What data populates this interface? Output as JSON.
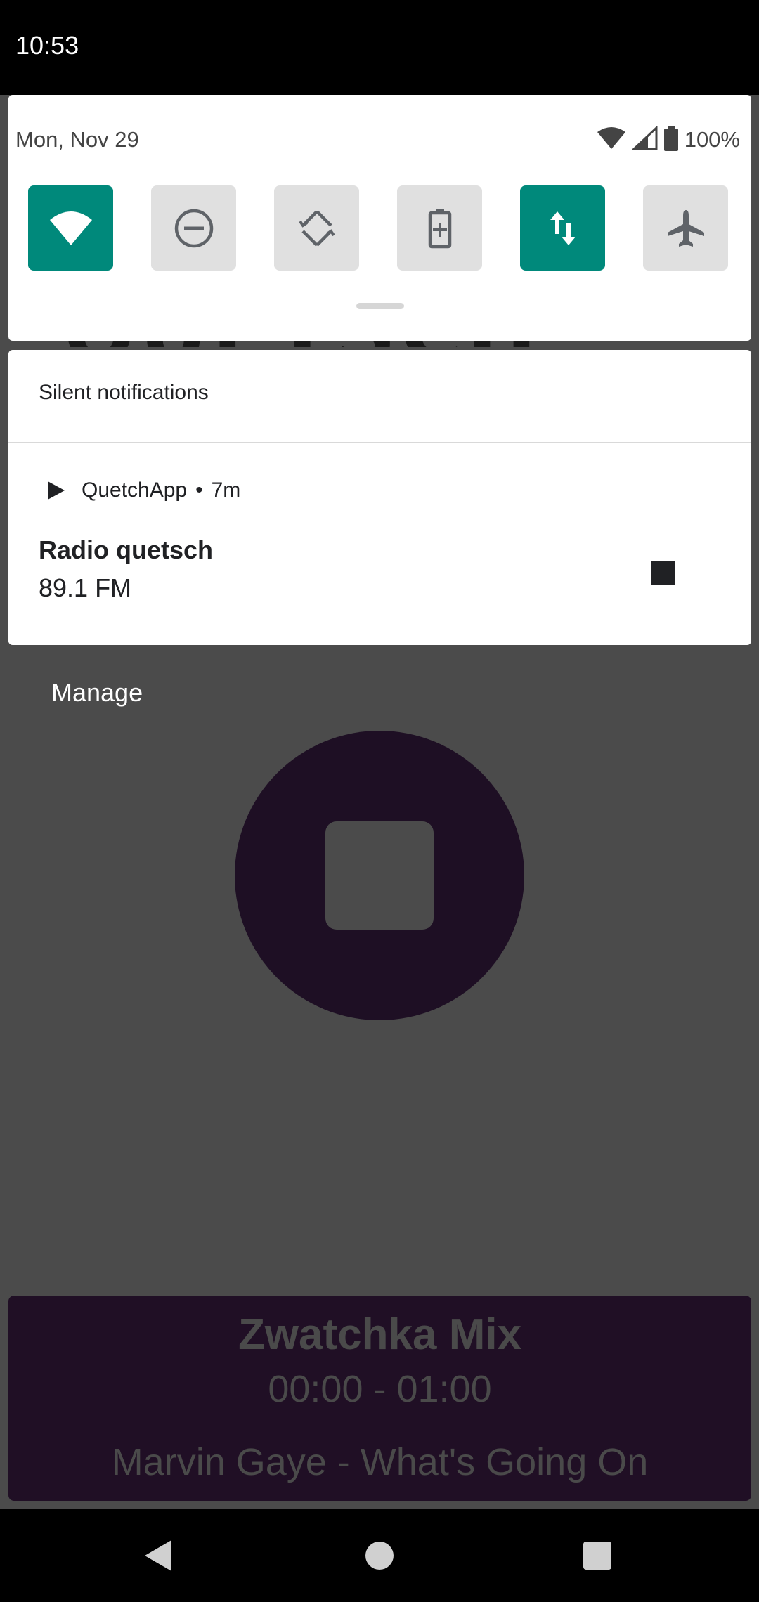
{
  "status_bar": {
    "time": "10:53"
  },
  "quick_settings": {
    "date": "Mon, Nov 29",
    "battery_percent": "100%",
    "status_icons": [
      "wifi-icon",
      "cellular-signal-icon",
      "battery-full-icon"
    ],
    "tiles": [
      {
        "name": "wifi",
        "icon": "wifi-icon",
        "active": true
      },
      {
        "name": "do-not-disturb",
        "icon": "do-not-disturb-icon",
        "active": false
      },
      {
        "name": "auto-rotate",
        "icon": "auto-rotate-icon",
        "active": false
      },
      {
        "name": "battery-saver",
        "icon": "battery-saver-icon",
        "active": false
      },
      {
        "name": "mobile-data",
        "icon": "mobile-data-icon",
        "active": true
      },
      {
        "name": "airplane-mode",
        "icon": "airplane-icon",
        "active": false
      }
    ],
    "colors": {
      "tile_active": "#00897b",
      "tile_inactive": "#e0e0e0"
    }
  },
  "notifications": {
    "section_header": "Silent notifications",
    "media": {
      "app_name": "QuetchApp",
      "separator": "•",
      "time_ago": "7m",
      "title": "Radio quetsch",
      "text": "89.1 FM",
      "action_icon": "stop-icon"
    },
    "manage_label": "Manage"
  },
  "app_background": {
    "show_title": "Zwatchka Mix",
    "show_time": "00:00 - 01:00",
    "track": "Marvin Gaye - What's Going On",
    "stop_button_icon": "stop-icon",
    "logo_text": "QUETSCH",
    "colors": {
      "accent": "#1e0f24",
      "scrim": "#4b4b4b"
    }
  },
  "navigation_bar": {
    "buttons": [
      "back-icon",
      "home-icon",
      "recents-icon"
    ]
  }
}
